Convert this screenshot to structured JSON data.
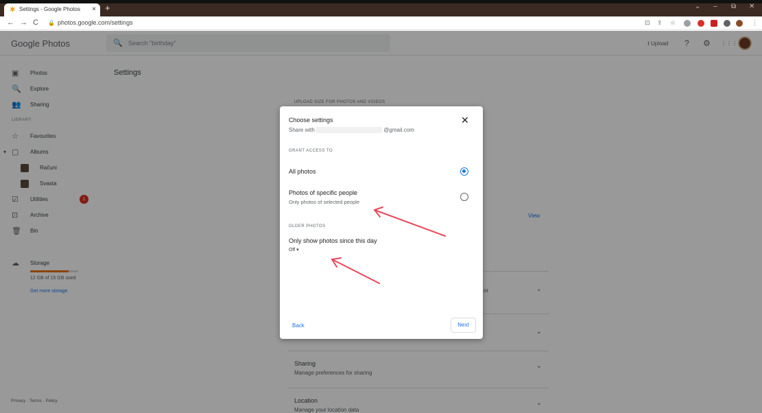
{
  "browser": {
    "tab_title": "Settings - Google Photos",
    "tab_close": "×",
    "new_tab": "+",
    "url": "photos.google.com/settings",
    "win_min": "‒",
    "win_restore": "⧉",
    "win_close": "✕",
    "win_chevron": "⌄",
    "nav_back": "←",
    "nav_forward": "→",
    "nav_reload": "C",
    "lock": "🔒",
    "extensions": [
      "⊡",
      "⇪",
      "☆",
      "⋮"
    ]
  },
  "app": {
    "logo": "Google Photos",
    "search_placeholder": "Search \"birthday\"",
    "search_icon": "🔍",
    "upload_label": "⭱ Upload",
    "help_icon": "?",
    "settings_icon": "⚙",
    "apps_icon": "⋮⋮⋮"
  },
  "sidebar": {
    "items": [
      {
        "icon": "▣",
        "label": "Photos"
      },
      {
        "icon": "🔍",
        "label": "Explore"
      },
      {
        "icon": "👥",
        "label": "Sharing"
      }
    ],
    "library_header": "LIBRARY",
    "library": [
      {
        "icon": "☆",
        "label": "Favourites"
      },
      {
        "icon": "▢",
        "label": "Albums",
        "expand": "▾"
      },
      {
        "label": "Računi"
      },
      {
        "label": "Svasta"
      },
      {
        "icon": "☑",
        "label": "Utilities",
        "badge": "1"
      },
      {
        "icon": "⊡",
        "label": "Archive"
      },
      {
        "icon": "🗑",
        "label": "Bin"
      }
    ],
    "storage_label": "Storage",
    "storage_icon": "☁",
    "storage_used": "12 GB of 15 GB used",
    "storage_fraction": 0.8,
    "get_more": "Get more storage",
    "footer": "Privacy · Terms · Policy"
  },
  "content": {
    "title": "Settings",
    "upload_size_header": "UPLOAD SIZE FOR PHOTOS AND VIDEOS",
    "view_link": "View",
    "row_fragment": "or",
    "rows": [
      {
        "title": "",
        "subtitle": ""
      },
      {
        "title": "",
        "subtitle": ""
      },
      {
        "title": "Sharing",
        "subtitle": "Manage preferences for sharing"
      },
      {
        "title": "Location",
        "subtitle": "Manage your location data"
      }
    ],
    "chevron": "⌄"
  },
  "dialog": {
    "title": "Choose settings",
    "share_prefix": "Share with",
    "share_email_suffix": "@gmail.com",
    "close_icon": "✕",
    "grant_header": "GRANT ACCESS TO",
    "option_all": "All photos",
    "option_specific": "Photos of specific people",
    "option_specific_sub": "Only photos of selected people",
    "selected_option": "All photos",
    "older_header": "OLDER PHOTOS",
    "older_label": "Only show photos since this day",
    "older_value": "Off ▾",
    "back": "Back",
    "next": "Next"
  },
  "colors": {
    "accent": "#1a73e8",
    "badge": "#d93025",
    "annotation_arrow": "#e8475a",
    "storage": "#e37400"
  }
}
